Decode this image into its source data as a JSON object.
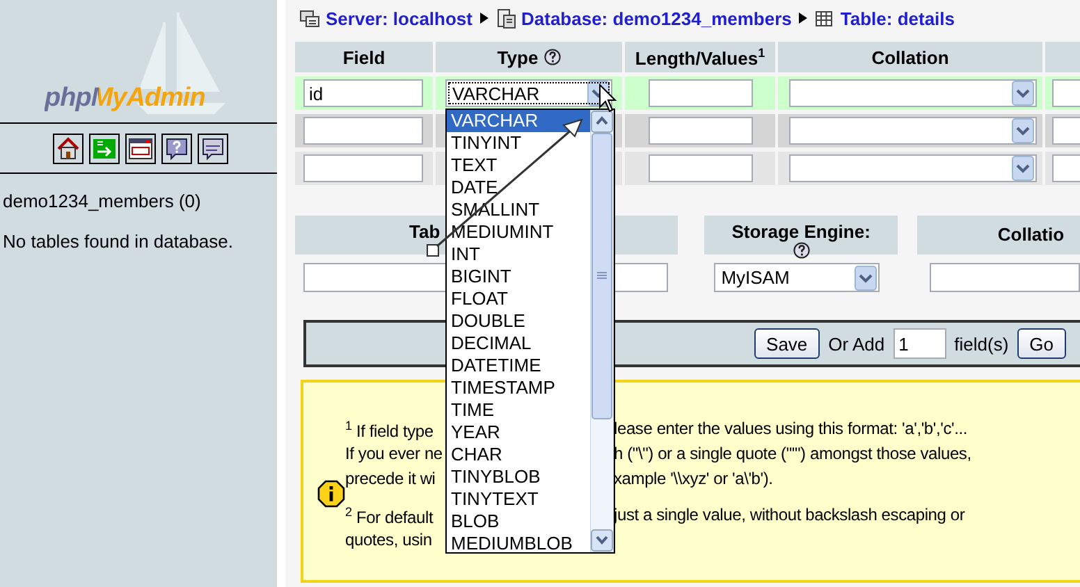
{
  "sidebar": {
    "logo": "phpMyAdmin",
    "database": "demo1234_members (0)",
    "message": "No tables found in database."
  },
  "breadcrumb": [
    {
      "kind": "server",
      "label": "Server: localhost"
    },
    {
      "kind": "database",
      "label": "Database: demo1234_members"
    },
    {
      "kind": "table",
      "label": "Table: details"
    }
  ],
  "fields_table": {
    "columns": [
      {
        "label": "Field",
        "help": false
      },
      {
        "label": "Type",
        "help": true
      },
      {
        "label": "Length/Values$^{1}$",
        "help": false
      },
      {
        "label": "Collation",
        "help": false
      }
    ],
    "rows": [
      {
        "field": "id",
        "type": "VARCHAR",
        "highlighted": true
      },
      {
        "highlighted": false
      },
      {
        "highlighted": false
      }
    ]
  },
  "type_dropdown": {
    "options": [
      {
        "label": "VARCHAR",
        "selected": true
      },
      {
        "label": "TINYINT",
        "selected": false
      },
      {
        "label": "TEXT",
        "selected": false
      },
      {
        "label": "DATE",
        "selected": false
      },
      {
        "label": "SMALLINT",
        "selected": false
      },
      {
        "label": "MEDIUMINT",
        "selected": false
      },
      {
        "label": "INT",
        "selected": false
      },
      {
        "label": "BIGINT",
        "selected": false
      },
      {
        "label": "FLOAT",
        "selected": false
      },
      {
        "label": "DOUBLE",
        "selected": false
      },
      {
        "label": "DECIMAL",
        "selected": false
      },
      {
        "label": "DATETIME",
        "selected": false
      },
      {
        "label": "TIMESTAMP",
        "selected": false
      },
      {
        "label": "TIME",
        "selected": false
      },
      {
        "label": "YEAR",
        "selected": false
      },
      {
        "label": "CHAR",
        "selected": false
      },
      {
        "label": "TINYBLOB",
        "selected": false
      },
      {
        "label": "TINYTEXT",
        "selected": false
      },
      {
        "label": "BLOB",
        "selected": false
      },
      {
        "label": "MEDIUMBLOB",
        "selected": false
      }
    ]
  },
  "table_options": {
    "columns": [
      {
        "label": "Tab",
        "help": false
      },
      {
        "label": "Storage Engine:",
        "help": true
      },
      {
        "label": "Collatio",
        "help": false
      }
    ],
    "storage_engine": "MyISAM"
  },
  "add_bar": {
    "save": "Save",
    "or_add": "Or Add",
    "count": "1",
    "unit": "field(s)",
    "go": "Go"
  },
  "note": {
    "paragraphs": [
      {
        "lines": [
          {
            "left": "$^{1}$ If field type",
            "right": "lease enter the values using this format: 'a','b','c'..."
          },
          {
            "left": "If you ever ne",
            "right": "h (\"\\\") or a single quote (\"'\") amongst those values,"
          },
          {
            "left": "precede it wi",
            "right": "xample '\\\\xyz' or 'a\\'b')."
          }
        ]
      },
      {
        "lines": [
          {
            "left": "$^{2}$ For default",
            "right": "just a single value, without backslash escaping or"
          },
          {
            "left": "quotes, usin"
          }
        ]
      }
    ]
  }
}
